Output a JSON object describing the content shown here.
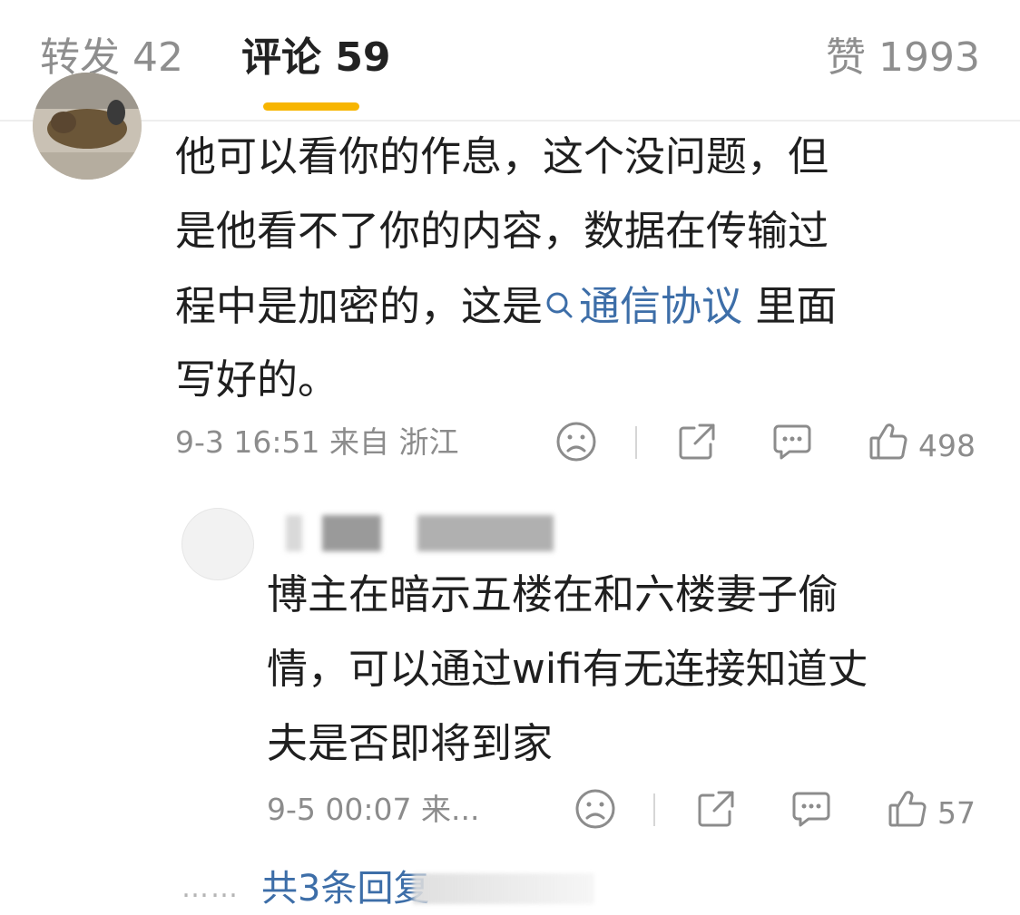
{
  "tabs": {
    "repost": "转发 42",
    "comment": "评论 59",
    "like": "赞 1993"
  },
  "comment": {
    "lines": [
      "他可以看你的作息，这个没问题，但",
      "是他看不了你的内容，数据在传输过"
    ],
    "line3_before": "程中是加密的，这是",
    "topic": "通信协议",
    "line3_after": " 里面",
    "line4": "写好的。",
    "meta": "9-3 16:51 来自 浙江",
    "likes": "498"
  },
  "reply": {
    "lines": [
      "博主在暗示五楼在和六楼妻子偷",
      "情，可以通过wifi有无连接知道丈",
      "夫是否即将到家"
    ],
    "meta": "9-5 00:07 来...",
    "likes": "57"
  },
  "more": {
    "dots": "……",
    "label": "共3条回复"
  },
  "icons": {
    "dislike": "sad-face-icon",
    "share": "share-icon",
    "comment": "comment-icon",
    "like": "thumbs-up-icon"
  },
  "colors": {
    "accent": "#f7b500",
    "link": "#3d6ea8",
    "muted": "#8c8c8c"
  }
}
